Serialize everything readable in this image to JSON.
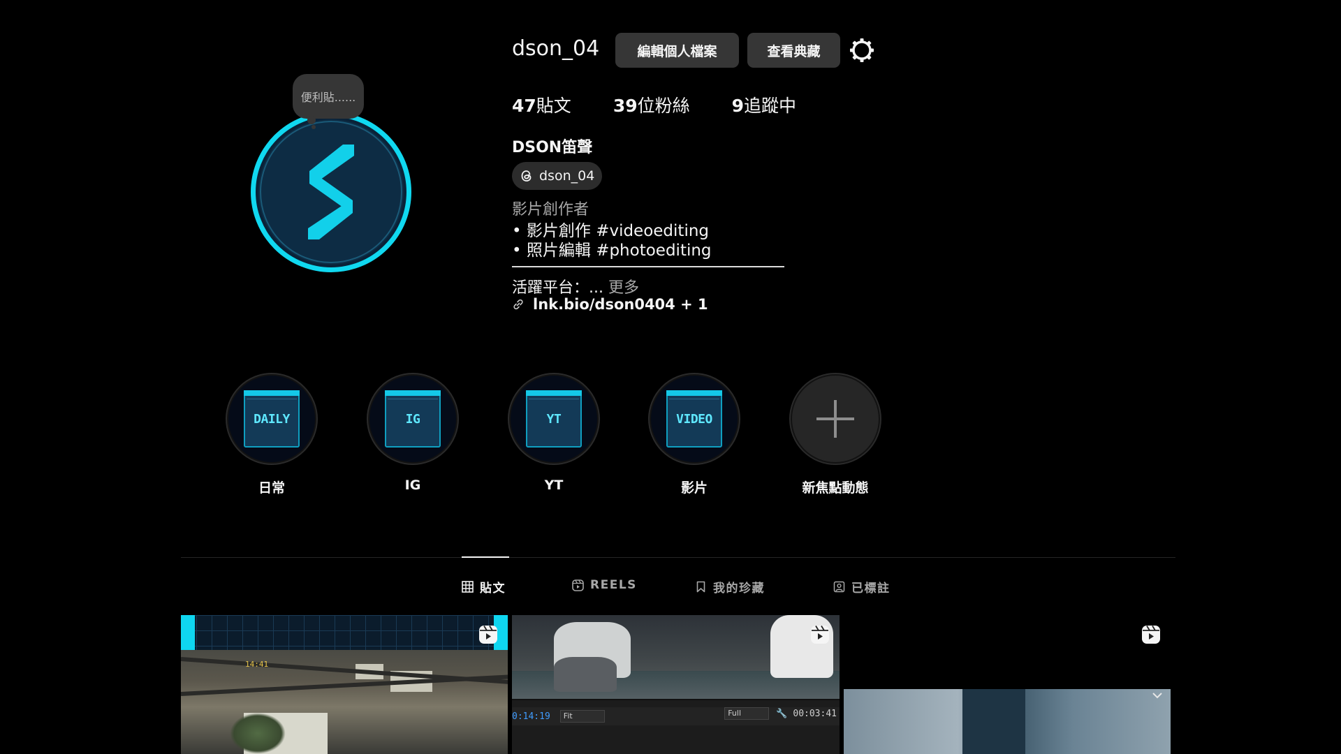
{
  "profile": {
    "username": "dson_04",
    "note": "便利貼......",
    "edit_button": "編輯個人檔案",
    "archive_button": "查看典藏",
    "settings_icon": "gear-icon",
    "stats": {
      "posts_count": "47",
      "posts_label": "貼文",
      "followers_count": "39",
      "followers_label": "位粉絲",
      "following_count": "9",
      "following_label": "追蹤中"
    },
    "full_name": "DSON笛聲",
    "threads_handle": "dson_04",
    "category": "影片創作者",
    "bio_line_1": "• 影片創作 #videoediting",
    "bio_line_2": "• 照片編輯 #photoediting",
    "platform_text": "活躍平台：...",
    "more_label": "更多",
    "link_text": "lnk.bio/dson0404 + 1"
  },
  "highlights": [
    {
      "label": "日常",
      "cover_text": "DAILY"
    },
    {
      "label": "IG",
      "cover_text": "IG"
    },
    {
      "label": "YT",
      "cover_text": "YT"
    },
    {
      "label": "影片",
      "cover_text": "VIDEO"
    },
    {
      "label": "新焦點動態",
      "cover_text": ""
    }
  ],
  "tabs": [
    {
      "label": "貼文",
      "icon": "grid-icon",
      "active": true
    },
    {
      "label": "REELS",
      "icon": "reels-icon",
      "active": false
    },
    {
      "label": "我的珍藏",
      "icon": "bookmark-icon",
      "active": false
    },
    {
      "label": "已標註",
      "icon": "tagged-icon",
      "active": false
    }
  ],
  "posts": [
    {
      "type": "reel",
      "hud_text": "14:41"
    },
    {
      "type": "reel",
      "timecode": "0:14:19",
      "fit_option": "Fit",
      "quality_option": "Full",
      "duration": "00:03:41"
    },
    {
      "type": "reel"
    }
  ],
  "colors": {
    "background": "#000000",
    "accent_cyan": "#10d8f0",
    "button_bg": "#363636",
    "muted_text": "#a8a8a8"
  }
}
